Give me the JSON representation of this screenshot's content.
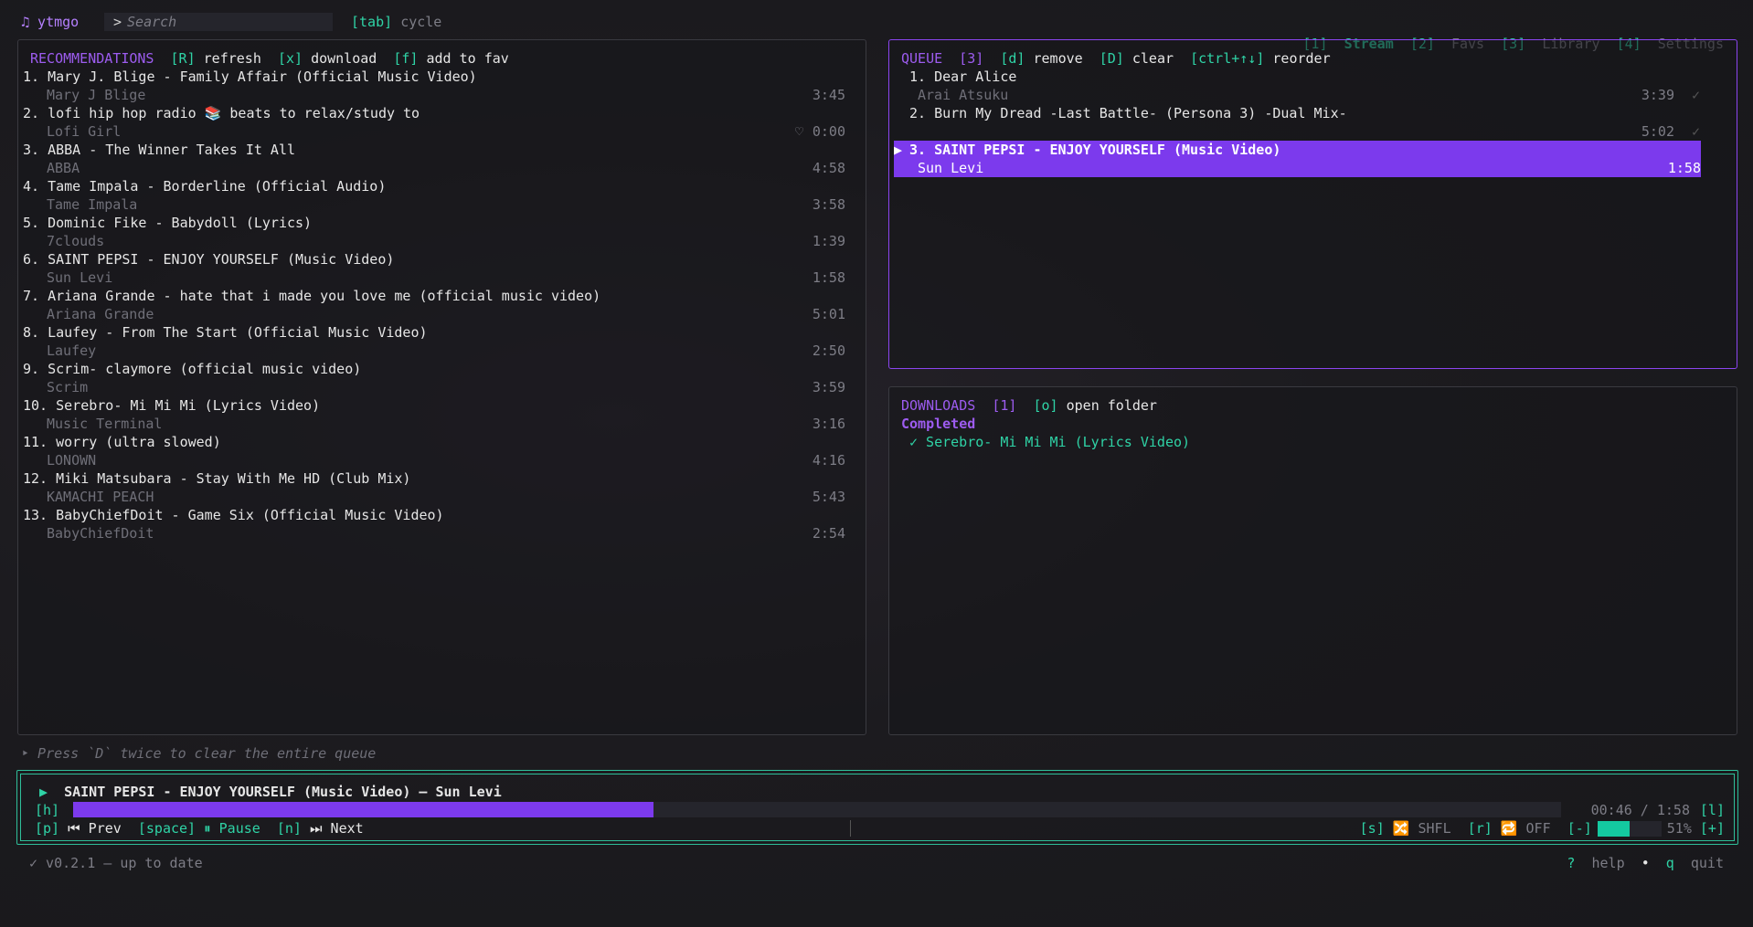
{
  "app": {
    "logo": "♫ ytmgo"
  },
  "search": {
    "caret": ">",
    "placeholder": "Search"
  },
  "cycle": {
    "key": "[tab]",
    "label": "cycle"
  },
  "tabs": [
    {
      "key": "[1]",
      "label": "Stream",
      "active": true
    },
    {
      "key": "[2]",
      "label": "Favs"
    },
    {
      "key": "[3]",
      "label": "Library"
    },
    {
      "key": "[4]",
      "label": "Settings"
    }
  ],
  "recommendations": {
    "title": "RECOMMENDATIONS",
    "actions": [
      {
        "key": "[R]",
        "label": "refresh"
      },
      {
        "key": "[x]",
        "label": "download"
      },
      {
        "key": "[f]",
        "label": "add to fav"
      }
    ],
    "items": [
      {
        "title": "1. Mary J. Blige - Family Affair (Official Music Video)",
        "artist": "Mary J Blige",
        "duration": "3:45"
      },
      {
        "title": "2. lofi hip hop radio 📚 beats to relax/study to",
        "artist": "Lofi Girl",
        "duration": "0:00",
        "favorite": true
      },
      {
        "title": "3. ABBA - The Winner Takes It All",
        "artist": "ABBA",
        "duration": "4:58"
      },
      {
        "title": "4. Tame Impala - Borderline (Official Audio)",
        "artist": "Tame Impala",
        "duration": "3:58"
      },
      {
        "title": "5. Dominic Fike - Babydoll (Lyrics)",
        "artist": "7clouds",
        "duration": "1:39"
      },
      {
        "title": "6. SAINT PEPSI - ENJOY YOURSELF (Music Video)",
        "artist": "Sun Levi",
        "duration": "1:58"
      },
      {
        "title": "7. Ariana Grande - hate that i made you love me (official music video)",
        "artist": "Ariana Grande",
        "duration": "5:01"
      },
      {
        "title": "8. Laufey - From The Start (Official Music Video)",
        "artist": "Laufey",
        "duration": "2:50"
      },
      {
        "title": "9. Scrim- claymore (official music video)",
        "artist": "Scrim",
        "duration": "3:59"
      },
      {
        "title": "10. Serebro- Mi Mi Mi (Lyrics Video)",
        "artist": "Music Terminal",
        "duration": "3:16"
      },
      {
        "title": "11. worry (ultra slowed)",
        "artist": "LONOWN",
        "duration": "4:16"
      },
      {
        "title": "12. Miki Matsubara - Stay With Me HD (Club Mix)",
        "artist": "KAMACHI PEACH",
        "duration": "5:43"
      },
      {
        "title": "13. BabyChiefDoit - Game Six (Official Music Video)",
        "artist": "BabyChiefDoit",
        "duration": "2:54"
      }
    ]
  },
  "queue": {
    "title": "QUEUE",
    "count": "[3]",
    "actions": [
      {
        "key": "[d]",
        "label": "remove"
      },
      {
        "key": "[D]",
        "label": "clear"
      },
      {
        "key": "[ctrl+↑↓]",
        "label": "reorder"
      }
    ],
    "items": [
      {
        "title": "1. Dear Alice",
        "artist": "Arai Atsuku",
        "duration": "3:39",
        "check": "✓"
      },
      {
        "title": "2. Burn My Dread -Last Battle- (Persona 3) -Dual Mix-",
        "artist": "",
        "duration": "5:02",
        "check": "✓"
      },
      {
        "marker": "▶",
        "title": "3. SAINT PEPSI - ENJOY YOURSELF (Music Video)",
        "artist": "Sun Levi",
        "duration": "1:58",
        "selected": true
      }
    ]
  },
  "downloads": {
    "title": "DOWNLOADS",
    "count": "[1]",
    "action": {
      "key": "[o]",
      "label": "open folder"
    },
    "section": "Completed",
    "items": [
      "✓ Serebro- Mi Mi Mi (Lyrics Video)"
    ]
  },
  "hint": "‣ Press `D` twice to clear the entire queue",
  "player": {
    "play_icon": "▶",
    "now_playing": "SAINT PEPSI - ENJOY YOURSELF (Music Video) — Sun Levi",
    "seek_back_key": "[h]",
    "seek_fwd_key": "[l]",
    "elapsed": "00:46",
    "total": "1:58",
    "progress": 0.39,
    "controls": [
      {
        "key": "[p]",
        "icon": "⏮",
        "label": "Prev"
      },
      {
        "key": "[space]",
        "icon": "⏸",
        "label": "Pause"
      },
      {
        "key": "[n]",
        "icon": "⏭",
        "label": "Next"
      }
    ],
    "shuffle": {
      "key": "[s]",
      "icon": "🔀",
      "label": "SHFL"
    },
    "repeat": {
      "key": "[r]",
      "icon": "🔁",
      "label": "OFF"
    },
    "volume": {
      "down_key": "[-]",
      "up_key": "[+]",
      "percent": "51%",
      "level": 0.51
    }
  },
  "footer": {
    "version": "✓ v0.2.1 — up to date",
    "help_key": "?",
    "help_label": "help",
    "separator": "•",
    "quit_key": "q",
    "quit_label": "quit"
  },
  "colors": {
    "accent_purple": "#7c3aed",
    "accent_teal": "#2fd3a6"
  }
}
